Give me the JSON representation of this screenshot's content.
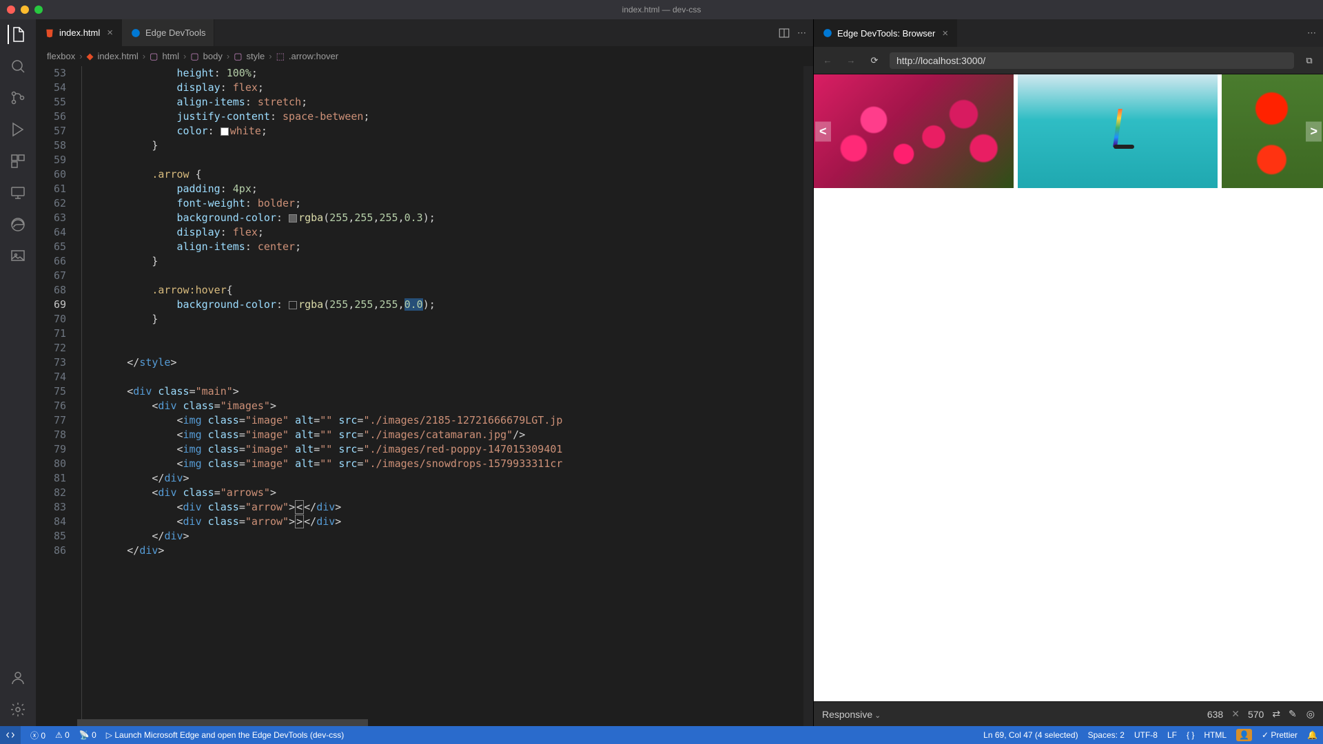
{
  "window": {
    "title": "index.html — dev-css"
  },
  "tabs": [
    {
      "label": "index.html",
      "icon": "html",
      "active": true
    },
    {
      "label": "Edge DevTools",
      "icon": "edge",
      "active": false
    }
  ],
  "devtools_tab": {
    "label": "Edge DevTools: Browser"
  },
  "breadcrumb": [
    "flexbox",
    "index.html",
    "html",
    "body",
    "style",
    ".arrow:hover"
  ],
  "address_url": "http://localhost:3000/",
  "code_start_line": 53,
  "current_line_num": 69,
  "lines": [
    {
      "n": 53,
      "indent": 4,
      "tokens": [
        [
          "kw",
          "height"
        ],
        [
          "punc",
          ": "
        ],
        [
          "num",
          "100%"
        ],
        [
          "punc",
          ";"
        ]
      ]
    },
    {
      "n": 54,
      "indent": 4,
      "tokens": [
        [
          "kw",
          "display"
        ],
        [
          "punc",
          ": "
        ],
        [
          "val",
          "flex"
        ],
        [
          "punc",
          ";"
        ]
      ]
    },
    {
      "n": 55,
      "indent": 4,
      "tokens": [
        [
          "kw",
          "align-items"
        ],
        [
          "punc",
          ": "
        ],
        [
          "val",
          "stretch"
        ],
        [
          "punc",
          ";"
        ]
      ]
    },
    {
      "n": 56,
      "indent": 4,
      "tokens": [
        [
          "kw",
          "justify-content"
        ],
        [
          "punc",
          ": "
        ],
        [
          "val",
          "space-between"
        ],
        [
          "punc",
          ";"
        ]
      ]
    },
    {
      "n": 57,
      "indent": 4,
      "tokens": [
        [
          "kw",
          "color"
        ],
        [
          "punc",
          ": "
        ],
        [
          "swatch",
          "#fff"
        ],
        [
          "val",
          "white"
        ],
        [
          "punc",
          ";"
        ]
      ]
    },
    {
      "n": 58,
      "indent": 3,
      "tokens": [
        [
          "punc",
          "}"
        ]
      ]
    },
    {
      "n": 59,
      "indent": 0,
      "tokens": []
    },
    {
      "n": 60,
      "indent": 3,
      "tokens": [
        [
          "sel",
          ".arrow"
        ],
        [
          "punc",
          " {"
        ]
      ]
    },
    {
      "n": 61,
      "indent": 4,
      "tokens": [
        [
          "kw",
          "padding"
        ],
        [
          "punc",
          ": "
        ],
        [
          "num",
          "4px"
        ],
        [
          "punc",
          ";"
        ]
      ]
    },
    {
      "n": 62,
      "indent": 4,
      "tokens": [
        [
          "kw",
          "font-weight"
        ],
        [
          "punc",
          ": "
        ],
        [
          "val",
          "bolder"
        ],
        [
          "punc",
          ";"
        ]
      ]
    },
    {
      "n": 63,
      "indent": 4,
      "tokens": [
        [
          "kw",
          "background-color"
        ],
        [
          "punc",
          ": "
        ],
        [
          "swatch",
          "rgba(255,255,255,0.3)"
        ],
        [
          "func",
          "rgba"
        ],
        [
          "punc",
          "("
        ],
        [
          "num",
          "255"
        ],
        [
          "punc",
          ","
        ],
        [
          "num",
          "255"
        ],
        [
          "punc",
          ","
        ],
        [
          "num",
          "255"
        ],
        [
          "punc",
          ","
        ],
        [
          "num",
          "0.3"
        ],
        [
          "punc",
          ");"
        ]
      ]
    },
    {
      "n": 64,
      "indent": 4,
      "tokens": [
        [
          "kw",
          "display"
        ],
        [
          "punc",
          ": "
        ],
        [
          "val",
          "flex"
        ],
        [
          "punc",
          ";"
        ]
      ]
    },
    {
      "n": 65,
      "indent": 4,
      "tokens": [
        [
          "kw",
          "align-items"
        ],
        [
          "punc",
          ": "
        ],
        [
          "val",
          "center"
        ],
        [
          "punc",
          ";"
        ]
      ]
    },
    {
      "n": 66,
      "indent": 3,
      "tokens": [
        [
          "punc",
          "}"
        ]
      ]
    },
    {
      "n": 67,
      "indent": 0,
      "tokens": []
    },
    {
      "n": 68,
      "indent": 3,
      "tokens": [
        [
          "sel",
          ".arrow:hover"
        ],
        [
          "punc",
          "{"
        ]
      ]
    },
    {
      "n": 69,
      "indent": 4,
      "tokens": [
        [
          "kw",
          "background-color"
        ],
        [
          "punc",
          ": "
        ],
        [
          "swatch",
          "rgba(255,255,255,0.0)"
        ],
        [
          "func",
          "rgba"
        ],
        [
          "punc",
          "("
        ],
        [
          "num",
          "255"
        ],
        [
          "punc",
          ","
        ],
        [
          "num",
          "255"
        ],
        [
          "punc",
          ","
        ],
        [
          "num",
          "255"
        ],
        [
          "punc",
          ","
        ],
        [
          "hl",
          "0.0"
        ],
        [
          "punc",
          ");"
        ]
      ]
    },
    {
      "n": 70,
      "indent": 3,
      "tokens": [
        [
          "punc",
          "}"
        ]
      ]
    },
    {
      "n": 71,
      "indent": 0,
      "tokens": []
    },
    {
      "n": 72,
      "indent": 0,
      "tokens": []
    },
    {
      "n": 73,
      "indent": 2,
      "tokens": [
        [
          "punc",
          "</"
        ],
        [
          "tag",
          "style"
        ],
        [
          "punc",
          ">"
        ]
      ]
    },
    {
      "n": 74,
      "indent": 0,
      "tokens": []
    },
    {
      "n": 75,
      "indent": 2,
      "tokens": [
        [
          "punc",
          "<"
        ],
        [
          "tag",
          "div"
        ],
        [
          "punc",
          " "
        ],
        [
          "attr",
          "class"
        ],
        [
          "punc",
          "="
        ],
        [
          "str",
          "\"main\""
        ],
        [
          "punc",
          ">"
        ]
      ]
    },
    {
      "n": 76,
      "indent": 3,
      "tokens": [
        [
          "punc",
          "<"
        ],
        [
          "tag",
          "div"
        ],
        [
          "punc",
          " "
        ],
        [
          "attr",
          "class"
        ],
        [
          "punc",
          "="
        ],
        [
          "str",
          "\"images\""
        ],
        [
          "punc",
          ">"
        ]
      ]
    },
    {
      "n": 77,
      "indent": 4,
      "tokens": [
        [
          "punc",
          "<"
        ],
        [
          "tag",
          "img"
        ],
        [
          "punc",
          " "
        ],
        [
          "attr",
          "class"
        ],
        [
          "punc",
          "="
        ],
        [
          "str",
          "\"image\""
        ],
        [
          "punc",
          " "
        ],
        [
          "attr",
          "alt"
        ],
        [
          "punc",
          "="
        ],
        [
          "str",
          "\"\""
        ],
        [
          "punc",
          " "
        ],
        [
          "attr",
          "src"
        ],
        [
          "punc",
          "="
        ],
        [
          "str",
          "\"./images/2185-12721666679LGT.jp"
        ]
      ]
    },
    {
      "n": 78,
      "indent": 4,
      "tokens": [
        [
          "punc",
          "<"
        ],
        [
          "tag",
          "img"
        ],
        [
          "punc",
          " "
        ],
        [
          "attr",
          "class"
        ],
        [
          "punc",
          "="
        ],
        [
          "str",
          "\"image\""
        ],
        [
          "punc",
          " "
        ],
        [
          "attr",
          "alt"
        ],
        [
          "punc",
          "="
        ],
        [
          "str",
          "\"\""
        ],
        [
          "punc",
          " "
        ],
        [
          "attr",
          "src"
        ],
        [
          "punc",
          "="
        ],
        [
          "str",
          "\"./images/catamaran.jpg\""
        ],
        [
          "punc",
          "/>"
        ]
      ]
    },
    {
      "n": 79,
      "indent": 4,
      "tokens": [
        [
          "punc",
          "<"
        ],
        [
          "tag",
          "img"
        ],
        [
          "punc",
          " "
        ],
        [
          "attr",
          "class"
        ],
        [
          "punc",
          "="
        ],
        [
          "str",
          "\"image\""
        ],
        [
          "punc",
          " "
        ],
        [
          "attr",
          "alt"
        ],
        [
          "punc",
          "="
        ],
        [
          "str",
          "\"\""
        ],
        [
          "punc",
          " "
        ],
        [
          "attr",
          "src"
        ],
        [
          "punc",
          "="
        ],
        [
          "str",
          "\"./images/red-poppy-147015309401"
        ]
      ]
    },
    {
      "n": 80,
      "indent": 4,
      "tokens": [
        [
          "punc",
          "<"
        ],
        [
          "tag",
          "img"
        ],
        [
          "punc",
          " "
        ],
        [
          "attr",
          "class"
        ],
        [
          "punc",
          "="
        ],
        [
          "str",
          "\"image\""
        ],
        [
          "punc",
          " "
        ],
        [
          "attr",
          "alt"
        ],
        [
          "punc",
          "="
        ],
        [
          "str",
          "\"\""
        ],
        [
          "punc",
          " "
        ],
        [
          "attr",
          "src"
        ],
        [
          "punc",
          "="
        ],
        [
          "str",
          "\"./images/snowdrops-1579933311cr"
        ]
      ]
    },
    {
      "n": 81,
      "indent": 3,
      "tokens": [
        [
          "punc",
          "</"
        ],
        [
          "tag",
          "div"
        ],
        [
          "punc",
          ">"
        ]
      ]
    },
    {
      "n": 82,
      "indent": 3,
      "tokens": [
        [
          "punc",
          "<"
        ],
        [
          "tag",
          "div"
        ],
        [
          "punc",
          " "
        ],
        [
          "attr",
          "class"
        ],
        [
          "punc",
          "="
        ],
        [
          "str",
          "\"arrows\""
        ],
        [
          "punc",
          ">"
        ]
      ]
    },
    {
      "n": 83,
      "indent": 4,
      "tokens": [
        [
          "punc",
          "<"
        ],
        [
          "tag",
          "div"
        ],
        [
          "punc",
          " "
        ],
        [
          "attr",
          "class"
        ],
        [
          "punc",
          "="
        ],
        [
          "str",
          "\"arrow\""
        ],
        [
          "punc",
          ">"
        ],
        [
          "hlbox",
          "<"
        ],
        [
          "punc",
          "</"
        ],
        [
          "tag",
          "div"
        ],
        [
          "punc",
          ">"
        ]
      ]
    },
    {
      "n": 84,
      "indent": 4,
      "tokens": [
        [
          "punc",
          "<"
        ],
        [
          "tag",
          "div"
        ],
        [
          "punc",
          " "
        ],
        [
          "attr",
          "class"
        ],
        [
          "punc",
          "="
        ],
        [
          "str",
          "\"arrow\""
        ],
        [
          "punc",
          ">"
        ],
        [
          "hlbox",
          ">"
        ],
        [
          "punc",
          "</"
        ],
        [
          "tag",
          "div"
        ],
        [
          "punc",
          ">"
        ]
      ]
    },
    {
      "n": 85,
      "indent": 3,
      "tokens": [
        [
          "punc",
          "</"
        ],
        [
          "tag",
          "div"
        ],
        [
          "punc",
          ">"
        ]
      ]
    },
    {
      "n": 86,
      "indent": 2,
      "tokens": [
        [
          "punc",
          "</"
        ],
        [
          "tag",
          "div"
        ],
        [
          "punc",
          ">"
        ]
      ]
    }
  ],
  "responsive": {
    "label": "Responsive",
    "width": "638",
    "height": "570"
  },
  "status": {
    "launch_text": "Launch Microsoft Edge and open the Edge DevTools (dev-css)",
    "errors": "0",
    "warnings": "0",
    "ports": "0",
    "cursor": "Ln 69, Col 47 (4 selected)",
    "spaces": "Spaces: 2",
    "encoding": "UTF-8",
    "eol": "LF",
    "lang": "HTML",
    "prettier": "Prettier"
  },
  "gallery_arrows": {
    "left": "<",
    "right": ">"
  }
}
